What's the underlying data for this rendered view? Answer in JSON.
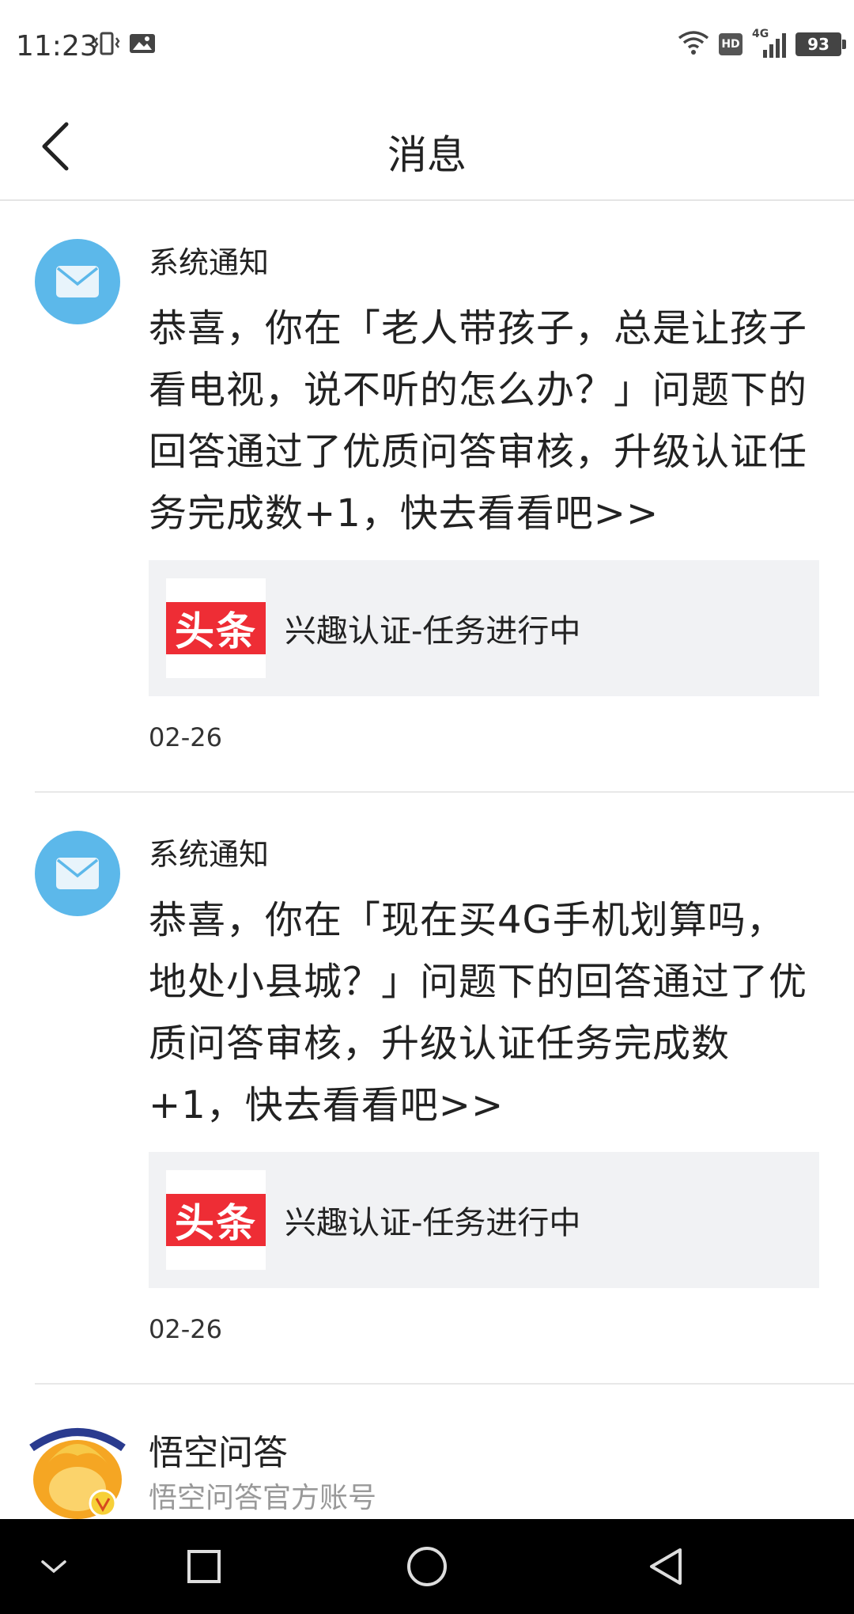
{
  "status_bar": {
    "time": "11:23",
    "hd_label": "HD",
    "network_label": "4G",
    "battery": "93",
    "icons": [
      "vibrate-icon",
      "image-icon",
      "wifi-icon",
      "signal-icon"
    ]
  },
  "header": {
    "title": "消息"
  },
  "messages": [
    {
      "sender": "系统通知",
      "text": "恭喜，你在「老人带孩子，总是让孩子看电视，说不听的怎么办？」问题下的回答通过了优质问答审核，升级认证任务完成数+1，快去看看吧>>",
      "link": {
        "logo": "头条",
        "title": "兴趣认证-任务进行中"
      },
      "date": "02-26"
    },
    {
      "sender": "系统通知",
      "text": "恭喜，你在「现在买4G手机划算吗，地处小县城？」问题下的回答通过了优质问答审核，升级认证任务完成数+1，快去看看吧>>",
      "link": {
        "logo": "头条",
        "title": "兴趣认证-任务进行中"
      },
      "date": "02-26"
    }
  ],
  "profile": {
    "name": "悟空问答",
    "description": "悟空问答官方账号"
  },
  "colors": {
    "avatar_blue": "#5cb8ea",
    "toutiao_red": "#ee2d35",
    "link_bg": "#f1f2f4",
    "nav_bg": "#000000"
  }
}
